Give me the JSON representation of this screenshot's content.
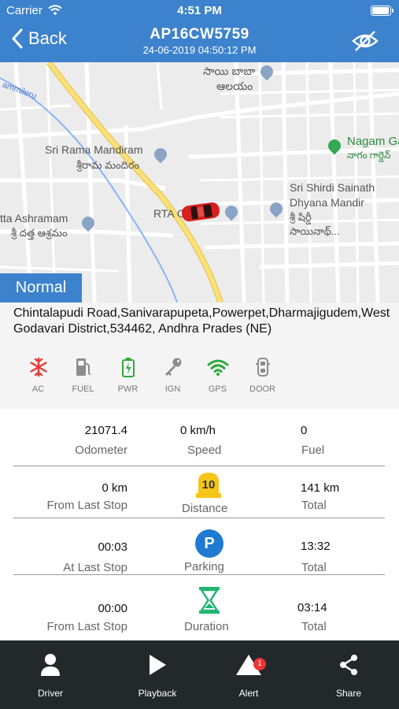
{
  "status": {
    "carrier": "Carrier",
    "time": "4:51 PM"
  },
  "nav": {
    "back_label": "Back",
    "title": "AP16CW5759",
    "subtitle": "24-06-2019 04:50:12 PM"
  },
  "map": {
    "labels": {
      "sai_baba": "సాయి బాబా",
      "sai_baba_2": "ఆలయం",
      "nagam_en": "Nagam Ga",
      "nagam_te": "నాగం గార్డెన్",
      "rama_en": "Sri Rama Mandiram",
      "rama_te": "శ్రీరామ మందిరం",
      "shirdi_en": "Sri Shirdi Sainath",
      "shirdi_en2": "Dhyana Mandir",
      "shirdi_te": "శ్రీ షిర్డీ",
      "shirdi_te2": "సాయినాథ్...",
      "ashram_en": "tta Ashramam",
      "ashram_te": "శ్రీ దత్త ఆశ్రమం",
      "rta": "RTA O",
      "road": "ammileru"
    }
  },
  "status_badge": "Normal",
  "address": "Chintalapudi Road,Sanivarapupeta,Powerpet,Dharmajigudem,West Godavari District,534462, Andhra Prades (NE)",
  "sensors": [
    {
      "label": "AC",
      "icon": "snowflake-icon",
      "color": "#e53935"
    },
    {
      "label": "FUEL",
      "icon": "fuel-pump-icon",
      "color": "#8c8c8c"
    },
    {
      "label": "PWR",
      "icon": "battery-icon",
      "color": "#2eaa3c"
    },
    {
      "label": "IGN",
      "icon": "key-icon",
      "color": "#8c8c8c"
    },
    {
      "label": "GPS",
      "icon": "wifi-icon",
      "color": "#2eaa3c"
    },
    {
      "label": "DOOR",
      "icon": "car-door-icon",
      "color": "#8c8c8c"
    }
  ],
  "stats": {
    "odometer": {
      "value": "21071.4",
      "label": "Odometer"
    },
    "speed": {
      "value": "0 km/h",
      "label": "Speed"
    },
    "fuel": {
      "value": "0",
      "label": "Fuel"
    },
    "distance_from_last_stop": {
      "value": "0 km",
      "label": "From Last Stop"
    },
    "distance_icon_value": "10",
    "distance_label": "Distance",
    "distance_total": {
      "value": "141 km",
      "label": "Total"
    },
    "parking_at_last_stop": {
      "value": "00:03",
      "label": "At Last Stop"
    },
    "parking_icon_letter": "P",
    "parking_label": "Parking",
    "parking_total": {
      "value": "13:32",
      "label": "Total"
    },
    "duration_from_last_stop": {
      "value": "00:00",
      "label": "From Last Stop"
    },
    "duration_label": "Duration",
    "duration_total": {
      "value": "03:14",
      "label": "Total"
    }
  },
  "tabs": {
    "driver": "Driver",
    "playback": "Playback",
    "alert": "Alert",
    "alert_count": "1",
    "share": "Share"
  },
  "colors": {
    "primary": "#3d82cc",
    "bottom_bar": "#23292b",
    "ok_green": "#2eaa3c",
    "alert_red": "#e53935"
  }
}
